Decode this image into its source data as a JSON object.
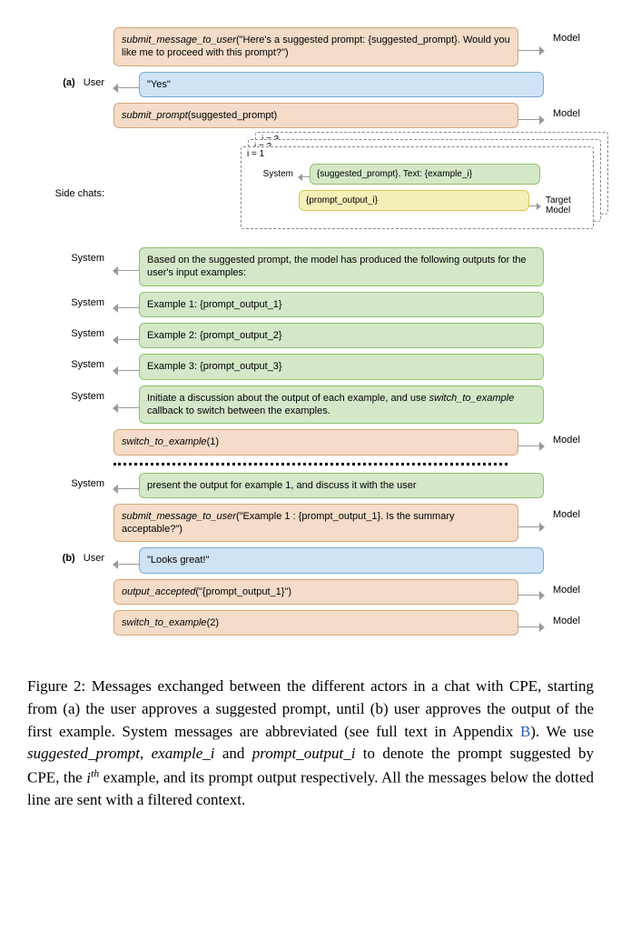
{
  "rows": {
    "r1": {
      "actor": "",
      "right": "Model",
      "text_html": "<span class='italic'>submit_message_to_user</span>(\"Here's a suggested prompt: {suggested_prompt}. Would you like me to proceed with this prompt?\")"
    },
    "r2": {
      "actor_html": "<span class='label-marker'>(a)</span> User",
      "text": "\"Yes\""
    },
    "r3": {
      "right": "Model",
      "text_html": "<span class='italic'>submit_prompt</span>(suggested_prompt)"
    },
    "side_label": "Side chats:",
    "idx": {
      "i1": "i = 1",
      "i2": "i = 2",
      "i3": "i = 3"
    },
    "mini_sys_actor": "System",
    "mini_sys": "{suggested_prompt}. Text: {example_i}",
    "mini_target_actor": "Target Model",
    "mini_target": "{prompt_output_i}",
    "r4": {
      "actor": "System",
      "text": "Based on the suggested prompt, the model has produced the following outputs for the user's input examples:"
    },
    "r5": {
      "actor": "System",
      "text": "Example 1: {prompt_output_1}"
    },
    "r6": {
      "actor": "System",
      "text": "Example 2: {prompt_output_2}"
    },
    "r7": {
      "actor": "System",
      "text": "Example 3: {prompt_output_3}"
    },
    "r8": {
      "actor": "System",
      "text_html": "Initiate a discussion about the output of each example, and use <span class='italic'>switch_to_example</span> callback to switch between the examples."
    },
    "r9": {
      "right": "Model",
      "text_html": "<span class='italic'>switch_to_example</span>(1)"
    },
    "r10": {
      "actor": "System",
      "text": "present the output for example 1, and discuss it with the user"
    },
    "r11": {
      "right": "Model",
      "text_html": "<span class='italic'>submit_message_to_user</span>(\"Example 1 : {prompt_output_1}. Is the summary acceptable?\")"
    },
    "r12": {
      "actor_html": "<span class='label-marker'>(b)</span> User",
      "text": "\"Looks great!\""
    },
    "r13": {
      "right": "Model",
      "text_html": "<span class='italic'>output_accepted</span>(\"{prompt_output_1}\")"
    },
    "r14": {
      "right": "Model",
      "text_html": "<span class='italic'>switch_to_example</span>(2)"
    }
  },
  "caption_html": "Figure 2: Messages exchanged between the different actors in a chat with CPE, starting from (a) the user approves a suggested prompt, until (b) user approves the output of the first example. System messages are abbreviated (see full text in Appendix <span class='link'>B</span>). We use <span class='italic'>suggested_prompt</span>, <span class='italic'>example_i</span> and <span class='italic'>prompt_output_i</span> to denote the prompt suggested by CPE, the <span class='italic'>i<sup>th</sup></span> example, and its prompt output respectively. All the messages below the dotted line are sent with a filtered context."
}
